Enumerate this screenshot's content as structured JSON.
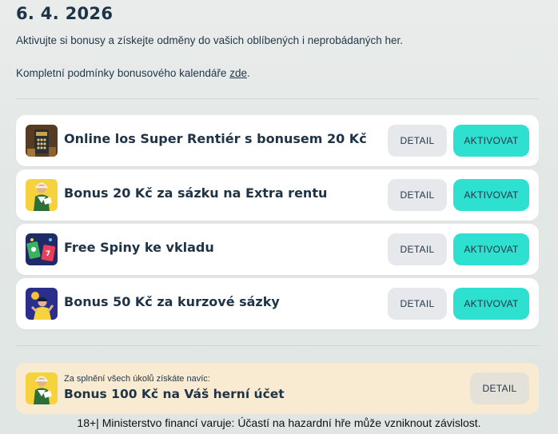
{
  "header": {
    "date": "6. 4. 2026",
    "intro": "Aktivujte si bonusy a získejte odměny do vašich oblíbených i neprobádaných her.",
    "terms_prefix": "Kompletní podmínky bonusového kalendáře ",
    "terms_link": "zde",
    "terms_suffix": "."
  },
  "offers": [
    {
      "title": "Online los Super Rentiér s bonusem 20 Kč",
      "icon": "scratch-ticket-icon",
      "detail": "DETAIL",
      "activate": "AKTIVOVAT"
    },
    {
      "title": "Bonus 20 Kč za sázku na Extra rentu",
      "icon": "lottery-player-icon",
      "detail": "DETAIL",
      "activate": "AKTIVOVAT"
    },
    {
      "title": "Free Spiny ke vkladu",
      "icon": "slot-machine-icon",
      "detail": "DETAIL",
      "activate": "AKTIVOVAT"
    },
    {
      "title": "Bonus 50 Kč za kurzové sázky",
      "icon": "sports-fan-icon",
      "detail": "DETAIL",
      "activate": "AKTIVOVAT"
    }
  ],
  "bonus": {
    "subtitle": "Za splnění všech úkolů získáte navíc:",
    "title": "Bonus 100 Kč na Váš herní účet",
    "detail": "DETAIL",
    "icon": "lottery-player-icon"
  },
  "footer": {
    "warning": "18+| Ministerstvo financí varuje: Účastí na hazardní hře může vzniknout závislost."
  },
  "colors": {
    "accent": "#2ee0cf",
    "text": "#1e3346",
    "detail_button": "#e6e8eb",
    "bonus_background": "#f9ebd1"
  }
}
